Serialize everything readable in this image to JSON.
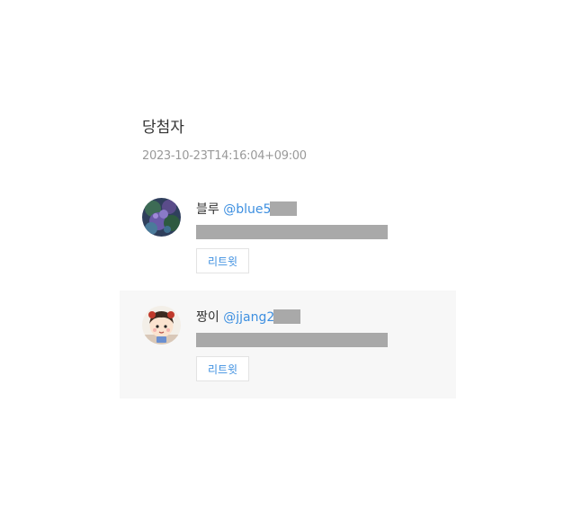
{
  "header": {
    "title": "당첨자",
    "timestamp": "2023-10-23T14:16:04+09:00"
  },
  "winners": [
    {
      "name": "블루",
      "handle": "@blue5",
      "retweet_label": "리트윗",
      "avatar_icon": "flower-painting-avatar"
    },
    {
      "name": "짱이",
      "handle": "@jjang2",
      "retweet_label": "리트윗",
      "avatar_icon": "cartoon-character-avatar"
    }
  ],
  "colors": {
    "handle": "#3d8fe0",
    "redaction": "#a9a9a9",
    "highlight_background": "#f7f7f7"
  }
}
